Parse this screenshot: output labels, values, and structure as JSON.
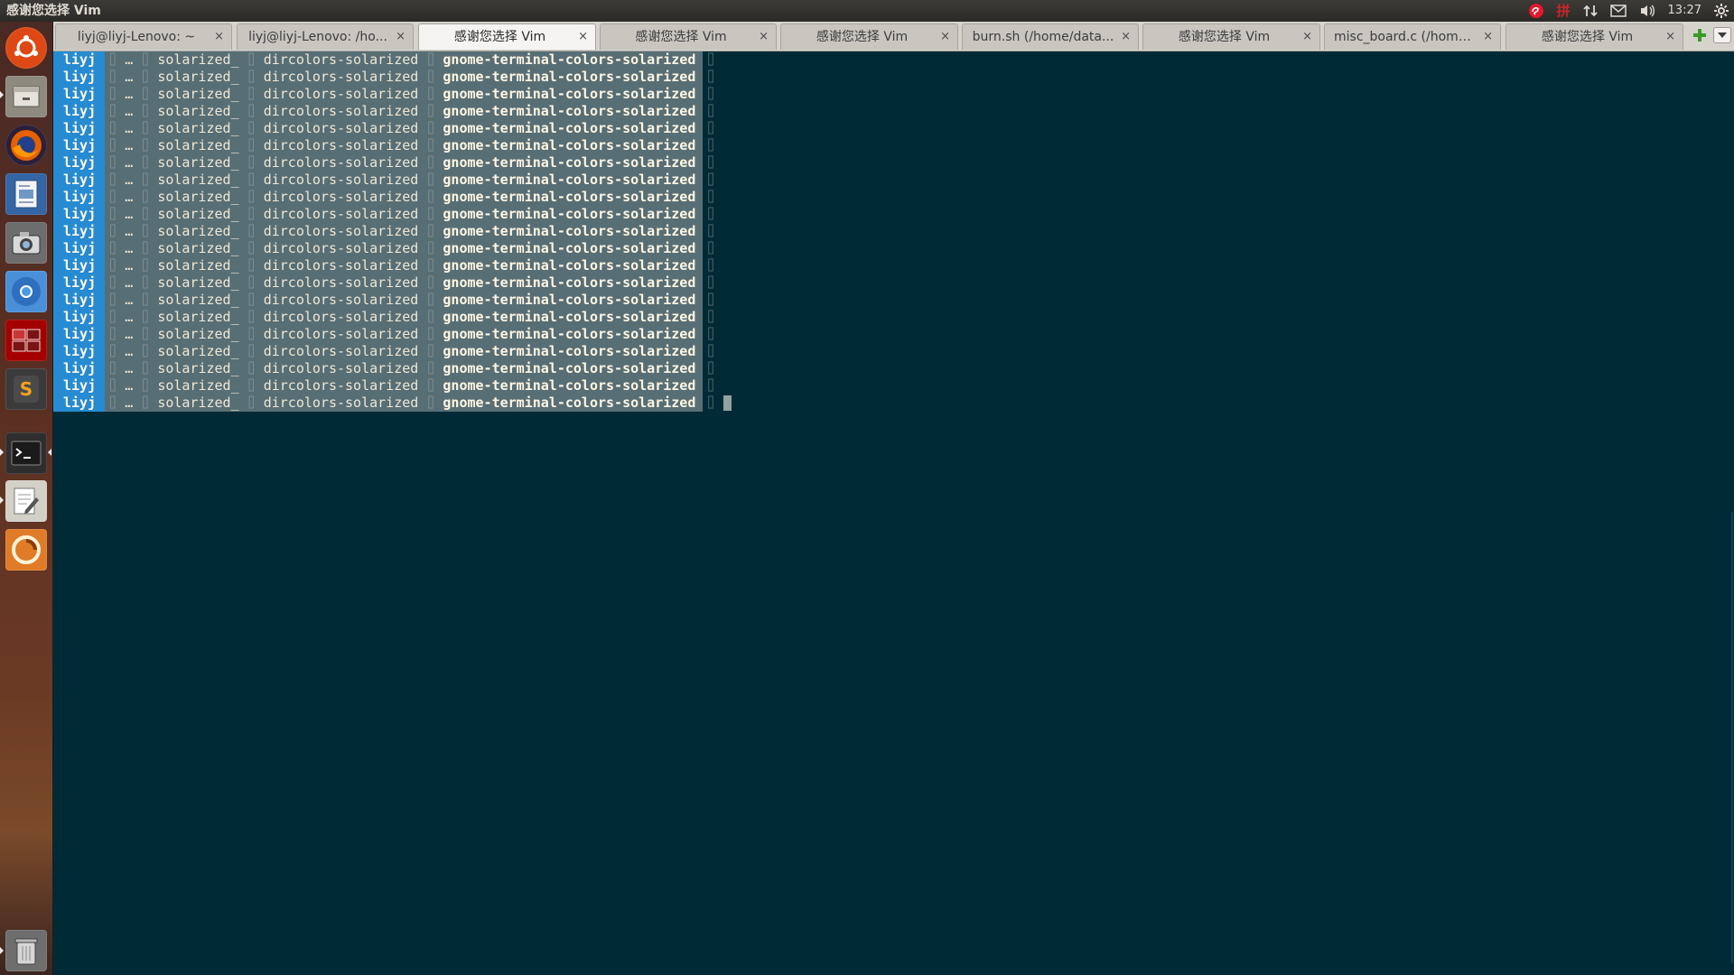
{
  "panel": {
    "window_title": "感谢您选择 Vim",
    "clock": "13:27",
    "indicators": [
      "weibo-icon",
      "input-method-icon",
      "network-icon",
      "mail-icon",
      "volume-icon",
      "settings-gear-icon"
    ],
    "input_method_label": "拼"
  },
  "launcher": {
    "items": [
      {
        "name": "ubuntu-dash-icon",
        "color": "#dd4814"
      },
      {
        "name": "files-icon",
        "color": "#8f8a80"
      },
      {
        "name": "firefox-icon",
        "color": "#e66000"
      },
      {
        "name": "document-viewer-icon",
        "color": "#3465a4"
      },
      {
        "name": "camera-icon",
        "color": "#6d6d6d"
      },
      {
        "name": "chromium-icon",
        "color": "#4a90d9"
      },
      {
        "name": "workspace-switcher-icon",
        "color": "#a40000"
      },
      {
        "name": "sublime-text-icon",
        "color": "#f2a21e"
      },
      {
        "name": "terminal-icon",
        "color": "#2e2e2e"
      },
      {
        "name": "text-editor-icon",
        "color": "#d3d0c8"
      },
      {
        "name": "software-center-icon",
        "color": "#e07b27"
      },
      {
        "name": "trash-icon",
        "color": "#9a9a9a"
      }
    ]
  },
  "tabs": [
    {
      "label": "liyj@liyj-Lenovo: ~",
      "close": "×",
      "active": false
    },
    {
      "label": "liyj@liyj-Lenovo: /ho...",
      "close": "×",
      "active": false
    },
    {
      "label": "感谢您选择 Vim",
      "close": "×",
      "active": true
    },
    {
      "label": "感谢您选择 Vim",
      "close": "×",
      "active": false
    },
    {
      "label": "感谢您选择 Vim",
      "close": "×",
      "active": false
    },
    {
      "label": "burn.sh (/home/data...",
      "close": "×",
      "active": false
    },
    {
      "label": "感谢您选择 Vim",
      "close": "×",
      "active": false
    },
    {
      "label": "misc_board.c (/home/...",
      "close": "×",
      "active": false
    },
    {
      "label": "感谢您选择 Vim",
      "close": "×",
      "active": false
    }
  ],
  "terminal": {
    "prompt": {
      "user": "liyj",
      "ellipsis": "…",
      "dir1": "solarized_",
      "dir2": "dircolors-solarized",
      "current_dir": "gnome-terminal-colors-solarized",
      "separator": "⌷"
    },
    "line_count": 21
  },
  "colors": {
    "background": "#002b36",
    "prompt_user_bg": "#268bd2",
    "prompt_path_bg": "#586e75",
    "tab_active_bg": "#f5f4f2",
    "tab_inactive_bg": "#c9c6c0"
  }
}
